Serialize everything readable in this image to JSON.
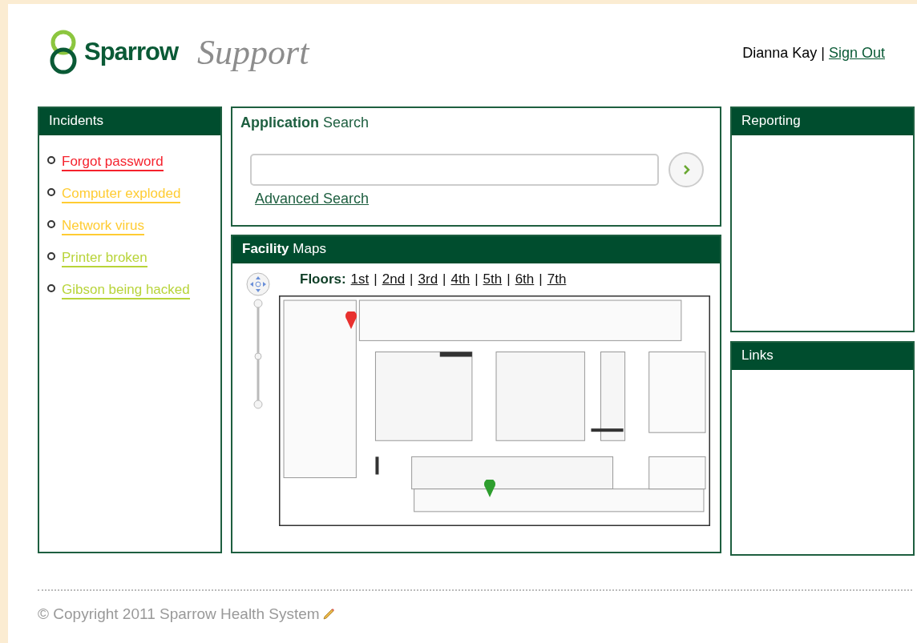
{
  "header": {
    "brand": "Sparrow",
    "product": "Support",
    "user": "Dianna Kay",
    "separator": "|",
    "sign_out": "Sign Out"
  },
  "incidents": {
    "title": "Incidents",
    "items": [
      {
        "label": "Forgot password",
        "color": "#f5222d"
      },
      {
        "label": "Computer exploded",
        "color": "#ffcc33"
      },
      {
        "label": "Network virus",
        "color": "#ffcc33"
      },
      {
        "label": "Printer broken",
        "color": "#b8d43a"
      },
      {
        "label": "Gibson being hacked",
        "color": "#b8d43a"
      }
    ]
  },
  "search": {
    "title_bold": "Application",
    "title_rest": "Search",
    "advanced": "Advanced Search"
  },
  "maps": {
    "title_bold": "Facility",
    "title_rest": "Maps",
    "floors_label": "Floors:",
    "separator": "|",
    "floors": [
      "1st",
      "2nd",
      "3rd",
      "4th",
      "5th",
      "6th",
      "7th"
    ],
    "markers": [
      {
        "color": "#e8312f"
      },
      {
        "color": "#2e9e2e"
      }
    ]
  },
  "reporting": {
    "title": "Reporting"
  },
  "links": {
    "title": "Links"
  },
  "footer": {
    "copyright": "© Copyright 2011 Sparrow Health System"
  }
}
